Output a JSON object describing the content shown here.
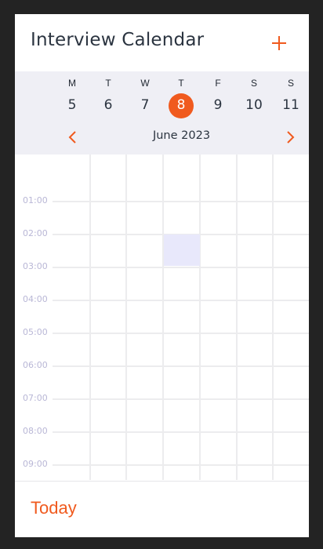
{
  "header": {
    "title": "Interview Calendar",
    "add_icon": "plus-icon"
  },
  "week": {
    "days": [
      {
        "letter": "M",
        "num": "5"
      },
      {
        "letter": "T",
        "num": "6"
      },
      {
        "letter": "W",
        "num": "7"
      },
      {
        "letter": "T",
        "num": "8"
      },
      {
        "letter": "F",
        "num": "9"
      },
      {
        "letter": "S",
        "num": "10"
      },
      {
        "letter": "S",
        "num": "11"
      }
    ],
    "selected_index": 3,
    "month": "June 2023",
    "prev_icon": "chevron-left-icon",
    "next_icon": "chevron-right-icon"
  },
  "times": [
    "01:00",
    "02:00",
    "03:00",
    "04:00",
    "05:00",
    "06:00",
    "07:00",
    "08:00",
    "09:00"
  ],
  "event": {
    "day_index": 3,
    "start_hour": "02:00",
    "end_hour": "03:00"
  },
  "footer": {
    "today_label": "Today"
  },
  "colors": {
    "accent": "#f05a1e",
    "band": "#efeff5",
    "event": "#e8e8fb",
    "time_text": "#b9b7d6",
    "frame": "#232323"
  }
}
